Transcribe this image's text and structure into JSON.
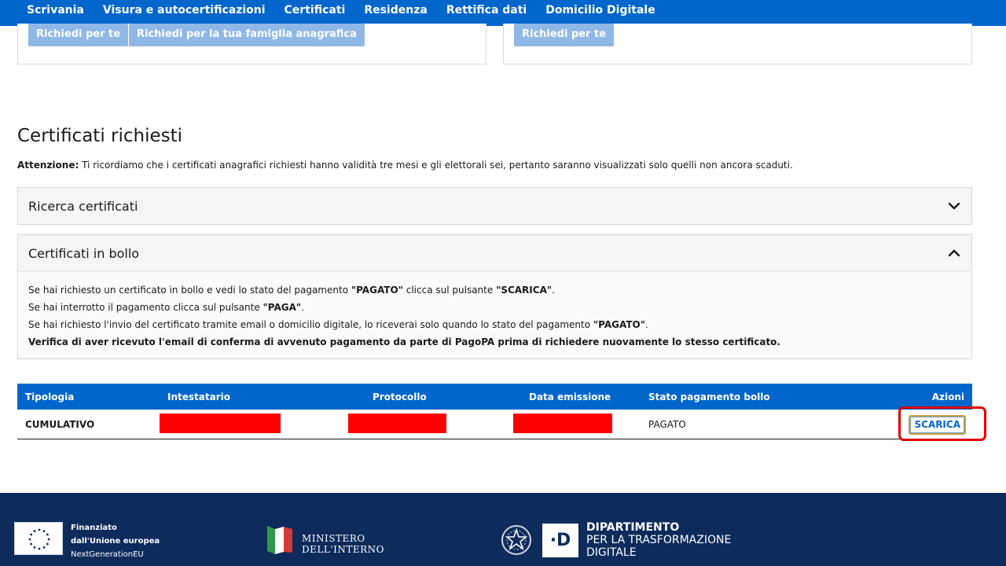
{
  "nav": {
    "items": [
      {
        "label": "Scrivania"
      },
      {
        "label": "Visura e autocertificazioni"
      },
      {
        "label": "Certificati",
        "active": true
      },
      {
        "label": "Residenza"
      },
      {
        "label": "Rettifica dati"
      },
      {
        "label": "Domicilio Digitale"
      }
    ]
  },
  "cards": {
    "left": {
      "btn_self": "Richiedi per te",
      "btn_family": "Richiedi per la tua famiglia anagrafica"
    },
    "right": {
      "btn_self": "Richiedi per te"
    }
  },
  "section": {
    "title": "Certificati richiesti",
    "notice_label": "Attenzione:",
    "notice_text": " Ti ricordiamo che i certificati anagrafici richiesti hanno validità tre mesi e gli elettorali sei, pertanto saranno visualizzati solo quelli non ancora scaduti."
  },
  "accordions": {
    "search": {
      "title": "Ricerca certificati"
    },
    "bollo": {
      "title": "Certificati in bollo",
      "line1_a": "Se hai richiesto un certificato in bollo e vedi lo stato del pagamento ",
      "line1_b": "\"PAGATO\"",
      "line1_c": " clicca sul pulsante ",
      "line1_d": "\"SCARICA\"",
      "line1_e": ".",
      "line2_a": "Se hai interrotto il pagamento clicca sul pulsante ",
      "line2_b": "\"PAGA\"",
      "line2_c": ".",
      "line3_a": "Se hai richiesto l'invio del certificato tramite email o domicilio digitale, lo riceverai solo quando lo stato del pagamento ",
      "line3_b": "\"PAGATO\"",
      "line3_c": ".",
      "line4": "Verifica di aver ricevuto l'email di conferma di avvenuto pagamento da parte di PagoPA prima di richiedere nuovamente lo stesso certificato."
    }
  },
  "table": {
    "headers": {
      "tipologia": "Tipologia",
      "intestatario": "Intestatario",
      "protocollo": "Protocollo",
      "data_emissione": "Data emissione",
      "stato": "Stato pagamento bollo",
      "azioni": "Azioni"
    },
    "rows": [
      {
        "tipologia": "CUMULATIVO",
        "stato": "PAGATO",
        "action_label": "SCARICA"
      }
    ]
  },
  "footer": {
    "eu_line1": "Finanziato",
    "eu_line2": "dall'Unione europea",
    "eu_line3": "NextGenerationEU",
    "ministero_line1": "MINISTERO",
    "ministero_line2": "DELL'INTERNO",
    "dtd_mark": "·D",
    "dtd_line1": "DIPARTIMENTO",
    "dtd_line2": "PER LA TRASFORMAZIONE",
    "dtd_line3": "DIGITALE"
  },
  "colors": {
    "primary": "#0066cc",
    "footer_bg": "#0d2b5b",
    "redaction": "#ff0000",
    "highlight": "#e00000"
  }
}
